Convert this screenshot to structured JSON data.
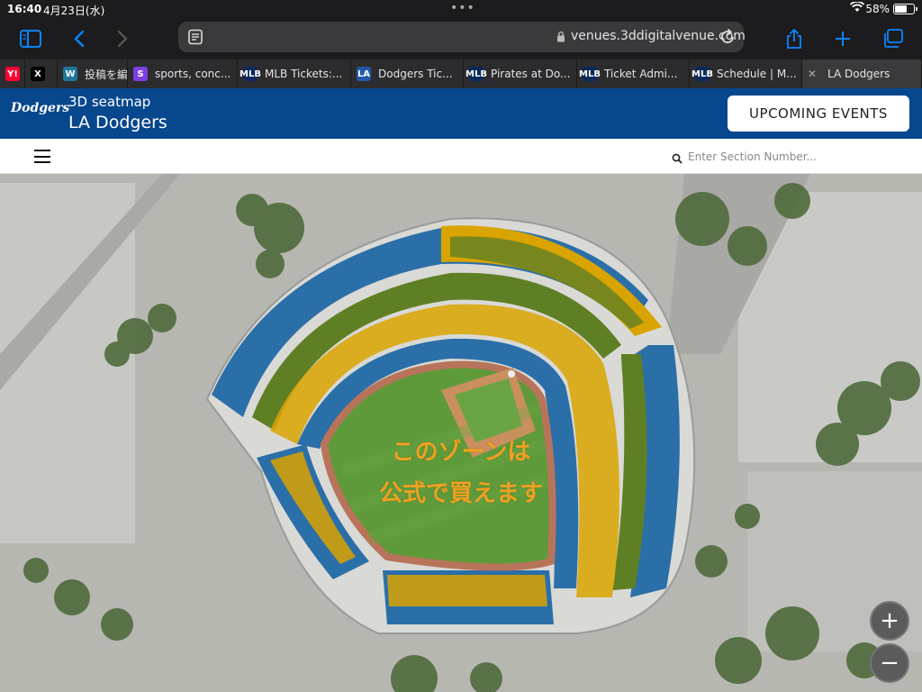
{
  "status": {
    "time": "16:40",
    "date": "4月23日(水)",
    "battery_text": "58%",
    "battery_level": 0.58
  },
  "browser": {
    "url": "venues.3ddigitalvenue.com",
    "tabs": [
      {
        "title": "",
        "fav": "Y!",
        "color": "#ff0033"
      },
      {
        "title": "",
        "fav": "X",
        "color": "#000000"
      },
      {
        "title": "投稿を編集",
        "fav": "W",
        "color": "#21759b"
      },
      {
        "title": "sports, conc...",
        "fav": "S",
        "color": "#7b3fe4"
      },
      {
        "title": "MLB Tickets:...",
        "fav": "MLB",
        "color": "#0b2a5b"
      },
      {
        "title": "Dodgers Tic...",
        "fav": "LA",
        "color": "#1e5aa8"
      },
      {
        "title": "Pirates at Do...",
        "fav": "MLB",
        "color": "#0b2a5b"
      },
      {
        "title": "Ticket Admi...",
        "fav": "MLB",
        "color": "#0b2a5b"
      },
      {
        "title": "Schedule | M...",
        "fav": "MLB",
        "color": "#0b2a5b"
      },
      {
        "title": "LA Dodgers",
        "fav": "",
        "color": "#555555",
        "active": true
      }
    ]
  },
  "site": {
    "logo_text": "Dodgers",
    "subtitle": "3D seatmap",
    "title": "LA Dodgers",
    "events_button": "UPCOMING EVENTS",
    "search_placeholder": "Enter Section Number..."
  },
  "map": {
    "overlay_line1": "このゾーンは",
    "overlay_line2": "公式で買えます",
    "zoom_in": "+",
    "zoom_out": "−",
    "colors": {
      "blue_section": "#2b6fa8",
      "yellow_section": "#d9a300",
      "green_section": "#5f7f24",
      "field": "#5f9a3a",
      "dirt": "#c98f5e",
      "overlay_text": "#f0a020"
    }
  }
}
